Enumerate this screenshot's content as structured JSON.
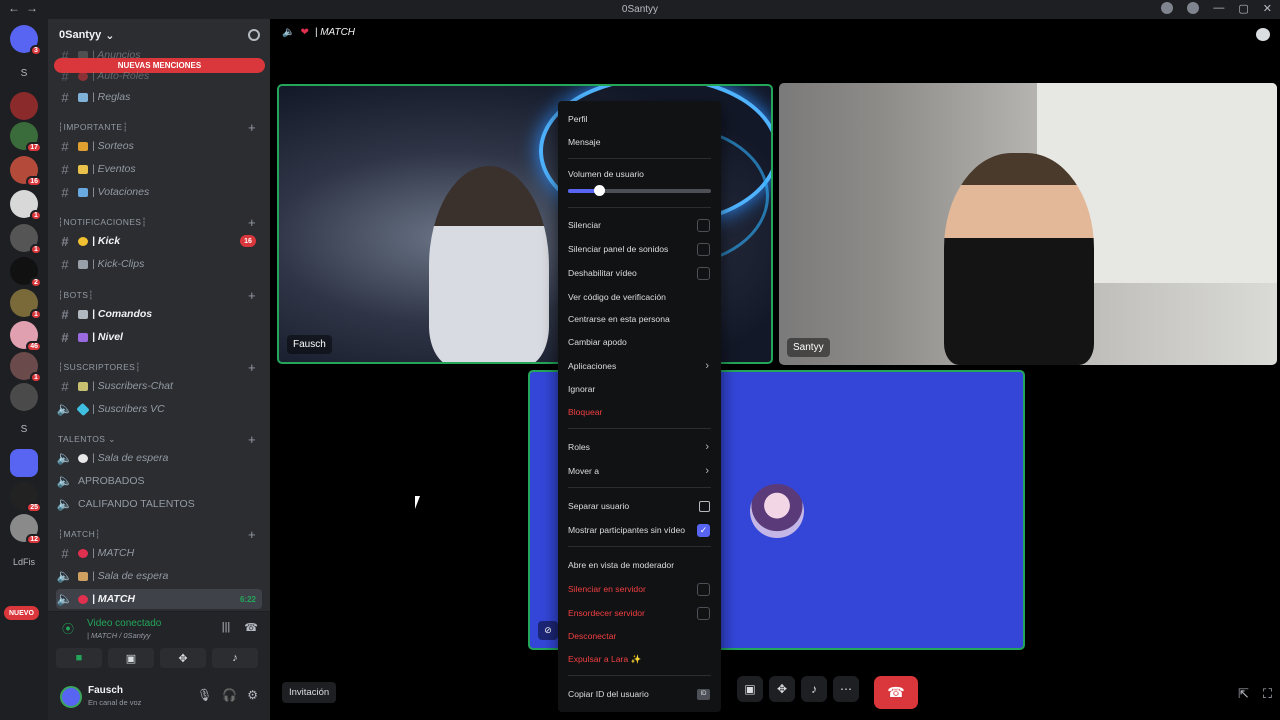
{
  "titlebar": {
    "title": "0Santyy",
    "back": "←",
    "fwd": "→"
  },
  "rail": {
    "badges": [
      "3",
      "17",
      "16",
      "1",
      "1",
      "2",
      "1",
      "46",
      "1",
      "25",
      "12"
    ],
    "letters": [
      "S",
      "S",
      "LdFis"
    ],
    "nuevo": "NUEVO"
  },
  "guild": {
    "name": "0Santyy",
    "new_mentions": "NUEVAS MENCIONES"
  },
  "channels": {
    "anuncios": "| Anuncios",
    "autoroles": "| Auto-Roles",
    "reglas": "| Reglas",
    "cat_importante": "┆IMPORTANTE┆",
    "sorteos": "| Sorteos",
    "eventos": "| Eventos",
    "votaciones": "| Votaciones",
    "cat_notificaciones": "┆NOTIFICACIONES┆",
    "kick": "| Kick",
    "kick_count": "16",
    "kickclips": "| Kick-Clips",
    "cat_bots": "┆BOTS┆",
    "comandos": "| Comandos",
    "nivel": "| Nivel",
    "cat_suscriptores": "┆SUSCRIPTORES┆",
    "suscchat": "| Suscribers-Chat",
    "suscvc": "| Suscribers VC",
    "cat_talentos": "TALENTOS",
    "espera1": "| Sala de espera",
    "aprobados": "APROBADOS",
    "califando": "CALIFANDO TALENTOS",
    "cat_match": "┆MATCH┆",
    "match_text": "| MATCH",
    "espera2": "| Sala de espera",
    "match_voice": "| MATCH",
    "match_time": "6:22"
  },
  "voice": {
    "status": "Video conectado",
    "channel": "| MATCH / 0Santyy"
  },
  "user": {
    "name": "Fausch",
    "sub": "En canal de voz"
  },
  "stage": {
    "header": "| MATCH",
    "tile1_name": "Fausch",
    "tile2_name": "Santyy",
    "invite": "Invitación"
  },
  "menu": {
    "perfil": "Perfil",
    "mensaje": "Mensaje",
    "volumen": "Volumen de usuario",
    "volumen_level": 0.22,
    "silenciar": "Silenciar",
    "silenciar_sonidos": "Silenciar panel de sonidos",
    "deshabilitar_video": "Deshabilitar vídeo",
    "ver_codigo": "Ver código de verificación",
    "centrarse": "Centrarse en esta persona",
    "cambiar_apodo": "Cambiar apodo",
    "aplicaciones": "Aplicaciones",
    "ignorar": "Ignorar",
    "bloquear": "Bloquear",
    "roles": "Roles",
    "mover": "Mover a",
    "separar": "Separar usuario",
    "mostrar_sin_video": "Mostrar participantes sin vídeo",
    "abrir_moderador": "Abre en vista de moderador",
    "silenciar_servidor": "Silenciar en servidor",
    "ensordecer_servidor": "Ensordecer servidor",
    "desconectar": "Desconectar",
    "expulsar": "Expulsar a Lara ✨",
    "copiar_id": "Copiar ID del usuario",
    "id_badge": "ID"
  },
  "colors": {
    "accent": "#5865f2",
    "danger": "#f23f42",
    "online": "#23a55a",
    "stage_blue": "#3346d8"
  },
  "icons": [
    "discord-icon",
    "add-user-icon",
    "hash-icon",
    "speaker-icon",
    "chat-icon",
    "hangup-icon",
    "camera-icon",
    "screen-share-icon",
    "activities-icon",
    "soundboard-icon",
    "mic-icon",
    "headphones-icon",
    "gear-icon",
    "popout-icon",
    "fullscreen-icon"
  ]
}
